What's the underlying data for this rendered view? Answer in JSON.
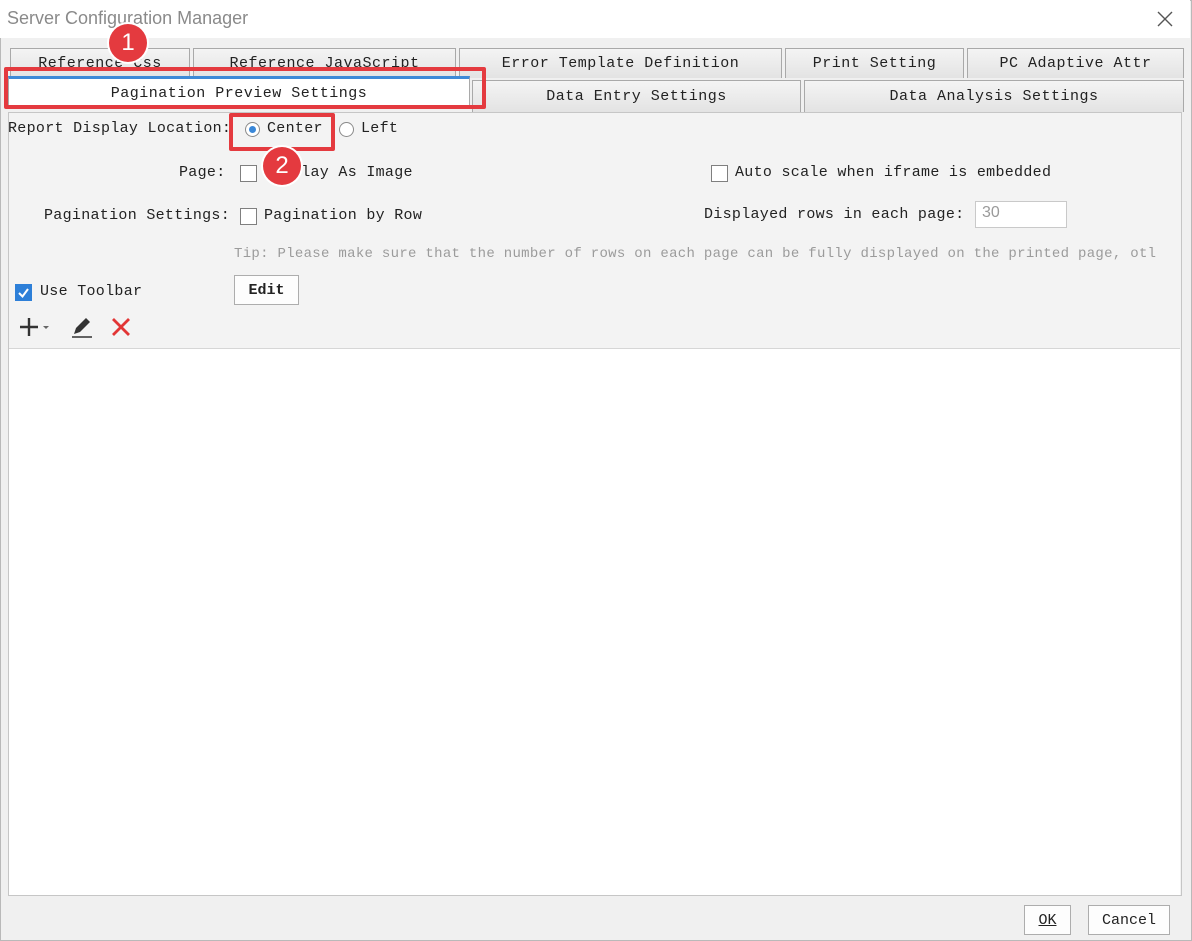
{
  "window": {
    "title": "Server Configuration Manager"
  },
  "tabs_row1": [
    {
      "label": "Reference Css"
    },
    {
      "label": "Reference JavaScript"
    },
    {
      "label": "Error Template Definition"
    },
    {
      "label": "Print Setting"
    },
    {
      "label": "PC Adaptive Attr"
    }
  ],
  "tabs_row2": [
    {
      "label": "Pagination Preview Settings",
      "selected": true
    },
    {
      "label": "Data Entry Settings"
    },
    {
      "label": "Data Analysis Settings"
    }
  ],
  "form": {
    "display_location_label": "Report Display Location:",
    "center_label": "Center",
    "left_label": "Left",
    "selected_location": "Center",
    "page_label": "Page:",
    "display_as_image_label": "Display As Image",
    "auto_scale_label": "Auto scale when iframe is embedded",
    "pagination_settings_label": "Pagination Settings:",
    "pagination_by_row_label": "Pagination by Row",
    "rows_per_page_label": "Displayed rows in each page:",
    "rows_per_page_value": "30",
    "tip": "Tip: Please make sure that the number of rows on each page can be fully displayed on the printed page, otl",
    "use_toolbar_label": "Use Toolbar",
    "use_toolbar_checked": true,
    "edit_button": "Edit"
  },
  "toolbar_icons": [
    "add-icon",
    "edit-pencil-icon",
    "delete-icon"
  ],
  "footer": {
    "ok": "OK",
    "cancel": "Cancel"
  },
  "annotations": [
    {
      "number": "1"
    },
    {
      "number": "2"
    }
  ],
  "colors": {
    "accent": "#3e8ad8",
    "highlight": "#e43a3f",
    "checkbox": "#2d7fd8"
  }
}
